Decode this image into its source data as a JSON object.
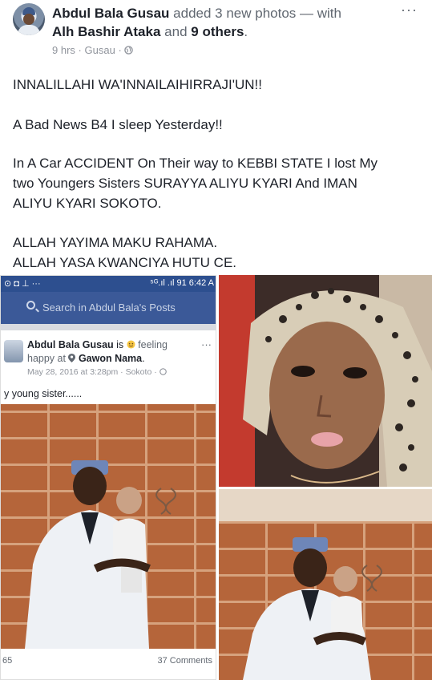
{
  "post": {
    "author": "Abdul Bala Gusau",
    "action": "added 3 new photos — with",
    "tagged_person": "Alh Bashir Ataka",
    "and_word": "and",
    "others": "9 others",
    "period": ".",
    "time": "9 hrs",
    "location": "Gusau",
    "separator": "·",
    "more": "···",
    "body": [
      "INNALILLAHI WA'INNAILAIHIRRAJI'UN!!",
      "A Bad News B4 I sleep Yesterday!!",
      "In A Car ACCIDENT On Their way to KEBBI STATE I lost My",
      "two Youngers Sisters SURAYYA ALIYU KYARI And IMAN",
      "ALIYU KYARI SOKOTO.",
      "ALLAH YAYIMA MAKU RAHAMA.",
      "ALLAH YASA KWANCIYA HUTU CE."
    ]
  },
  "embedded": {
    "status_left": "⊙ ◘ ⊥ ···",
    "status_right": "⁵ᴳ.ıl .ıl 91 6:42 A",
    "search_placeholder": "Search in Abdul Bala's Posts",
    "author": "Abdul Bala Gusau",
    "is": "is",
    "feeling": "feeling",
    "happy": "happy at",
    "place": "Gawon Nama",
    "period": ".",
    "date": "May 28, 2016 at 3:28pm",
    "location": "Sokoto",
    "more": "···",
    "caption": "y young sister......",
    "reactions": "65",
    "comments": "37 Comments"
  },
  "icons": {
    "globe": "globe-icon",
    "search": "search-icon",
    "smiley": "smiley-icon",
    "pin": "location-pin-icon"
  },
  "colors": {
    "facebook_blue": "#3b5998",
    "text": "#1d2129",
    "meta_grey": "#90949c"
  }
}
